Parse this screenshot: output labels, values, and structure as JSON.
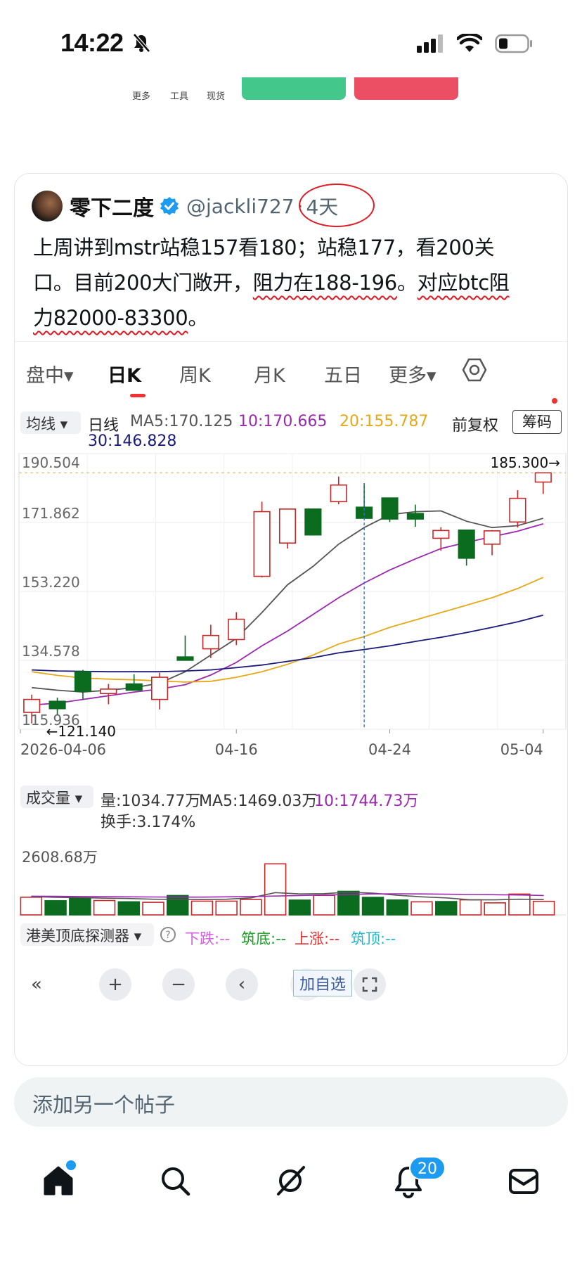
{
  "status_bar": {
    "time": "14:22"
  },
  "background_toolbar": {
    "items": [
      "更多",
      "工具",
      "现货"
    ]
  },
  "tweet": {
    "author": "零下二度",
    "handle": "@jackli727",
    "separator": "·",
    "age": "4天",
    "text": {
      "line1": "上周讲到mstr站稳157看180；站稳177，看200关",
      "line2_plain": "口。目前200大门敞开，",
      "line2_mark1": "阻力在188-196",
      "line2_mid": "。",
      "line2_mark2": "对应btc阻",
      "line3_mark": "力82000-83300",
      "line3_tail": "。"
    }
  },
  "screenshot": {
    "tabs": [
      "盘中",
      "日K",
      "周K",
      "月K",
      "五日",
      "更多"
    ],
    "active_tab": "日K",
    "ma_selector": "均线",
    "ma_label": "日线",
    "ma5": "MA5:170.125",
    "ma10": "10:170.665",
    "ma20": "20:155.787",
    "ma30": "30:146.828",
    "adjust": "前复权",
    "chips": "筹码",
    "price_axis": [
      "190.504",
      "171.862",
      "153.220",
      "134.578",
      "115.936"
    ],
    "high_marker": "185.300→",
    "low_marker": "←121.140",
    "date_axis": [
      "2026-04-06",
      "04-16",
      "04-24",
      "05-04"
    ],
    "add_watch": "加自选",
    "volume": {
      "selector": "成交量",
      "qty": "量:1034.77万",
      "ma5": "MA5:1469.03万",
      "ma10": "10:1744.73万",
      "turnover": "换手:3.174%",
      "axis_max": "2608.68万"
    },
    "detector": {
      "name": "港美顶底探测器",
      "down": "下跌:--",
      "bottom": "筑底:--",
      "up": "上涨:--",
      "top": "筑顶:--"
    }
  },
  "composer": {
    "placeholder": "添加另一个帖子"
  },
  "bottom_nav": {
    "notifications_badge": "20"
  },
  "colors": {
    "up": "#c62828",
    "down": "#0b6b1e",
    "ma5": "#555555",
    "ma10": "#9c27b0",
    "ma20": "#e6a817",
    "ma30": "#1a1a7a",
    "accent": "#1d9bf0",
    "annotation": "#e01a22"
  },
  "chart_data": {
    "type": "candlestick",
    "x": [
      "04-06",
      "04-07",
      "04-08",
      "04-09",
      "04-10",
      "04-13",
      "04-14",
      "04-15",
      "04-16",
      "04-17",
      "04-20",
      "04-21",
      "04-22",
      "04-23",
      "04-24",
      "04-27",
      "04-28",
      "04-29",
      "04-30",
      "05-01",
      "05-04"
    ],
    "candles": [
      {
        "o": 120.5,
        "h": 125.3,
        "l": 117.5,
        "c": 124.0
      },
      {
        "o": 123.5,
        "h": 124.5,
        "l": 119.8,
        "c": 121.5
      },
      {
        "o": 131.5,
        "h": 132.0,
        "l": 124.0,
        "c": 126.2
      },
      {
        "o": 125.6,
        "h": 128.2,
        "l": 122.7,
        "c": 126.8
      },
      {
        "o": 128.2,
        "h": 130.8,
        "l": 126.5,
        "c": 126.5
      },
      {
        "o": 124.0,
        "h": 131.2,
        "l": 121.3,
        "c": 130.0
      },
      {
        "o": 135.5,
        "h": 141.3,
        "l": 134.6,
        "c": 134.6
      },
      {
        "o": 137.7,
        "h": 144.2,
        "l": 135.2,
        "c": 141.3
      },
      {
        "o": 140.2,
        "h": 147.6,
        "l": 138.7,
        "c": 145.7
      },
      {
        "o": 157.3,
        "h": 177.5,
        "l": 157.0,
        "c": 174.8
      },
      {
        "o": 166.3,
        "h": 175.5,
        "l": 164.8,
        "c": 175.5
      },
      {
        "o": 175.5,
        "h": 175.5,
        "l": 168.5,
        "c": 168.5
      },
      {
        "o": 177.5,
        "h": 184.3,
        "l": 176.8,
        "c": 182.0
      },
      {
        "o": 176.0,
        "h": 182.5,
        "l": 174.8,
        "c": 173.0
      },
      {
        "o": 178.5,
        "h": 178.5,
        "l": 172.0,
        "c": 172.8
      },
      {
        "o": 174.3,
        "h": 176.7,
        "l": 170.7,
        "c": 172.8
      },
      {
        "o": 167.6,
        "h": 170.6,
        "l": 164.2,
        "c": 169.7
      },
      {
        "o": 169.8,
        "h": 169.8,
        "l": 160.2,
        "c": 162.2
      },
      {
        "o": 166.0,
        "h": 169.8,
        "l": 163.0,
        "c": 169.6
      },
      {
        "o": 172.0,
        "h": 180.6,
        "l": 170.5,
        "c": 178.4
      },
      {
        "o": 182.8,
        "h": 185.3,
        "l": 179.6,
        "c": 185.3
      }
    ],
    "series": [
      {
        "name": "MA5",
        "values": [
          127.2,
          126.5,
          126.0,
          126.5,
          127.2,
          128.4,
          131.5,
          136.0,
          140.5,
          147.5,
          155.0,
          160.0,
          166.0,
          170.5,
          174.0,
          174.8,
          175.0,
          172.2,
          170.5,
          171.0,
          173.0
        ]
      },
      {
        "name": "10",
        "values": [
          122.5,
          123.0,
          124.0,
          125.0,
          126.0,
          126.8,
          128.0,
          130.6,
          134.0,
          138.5,
          142.5,
          147.0,
          151.5,
          155.5,
          159.0,
          162.0,
          164.8,
          166.5,
          168.0,
          169.5,
          171.5
        ]
      },
      {
        "name": "20",
        "values": [
          131.5,
          130.5,
          129.8,
          129.5,
          129.3,
          129.0,
          128.7,
          128.9,
          130.0,
          131.5,
          133.5,
          136.0,
          139.0,
          141.0,
          143.5,
          145.5,
          147.5,
          149.5,
          151.5,
          154.0,
          157.0
        ]
      },
      {
        "name": "30",
        "values": [
          132.0,
          131.7,
          131.6,
          131.5,
          131.5,
          131.5,
          131.7,
          132.0,
          132.6,
          133.3,
          134.3,
          135.3,
          136.6,
          137.5,
          138.5,
          139.7,
          140.8,
          142.1,
          143.5,
          145.0,
          146.8
        ]
      }
    ],
    "ylim": [
      115.936,
      190.504
    ],
    "volume": {
      "values": [
        1350,
        1080,
        1250,
        1100,
        1000,
        960,
        1480,
        1050,
        1050,
        1180,
        3900,
        1130,
        1490,
        1800,
        1340,
        1140,
        1000,
        1020,
        1150,
        920,
        1590,
        1035
      ],
      "vol_ma5": [
        1400,
        1350,
        1320,
        1280,
        1250,
        1200,
        1180,
        1170,
        1200,
        1300,
        1700,
        1600,
        1620,
        1740,
        1660,
        1500,
        1380,
        1300,
        1150,
        1150,
        1200,
        1170
      ],
      "vol_ma10": [
        1430,
        1420,
        1400,
        1390,
        1380,
        1370,
        1360,
        1360,
        1380,
        1400,
        1440,
        1480,
        1520,
        1560,
        1600,
        1610,
        1600,
        1580,
        1560,
        1540,
        1520,
        1480
      ],
      "ylim": [
        0,
        4000
      ]
    }
  }
}
